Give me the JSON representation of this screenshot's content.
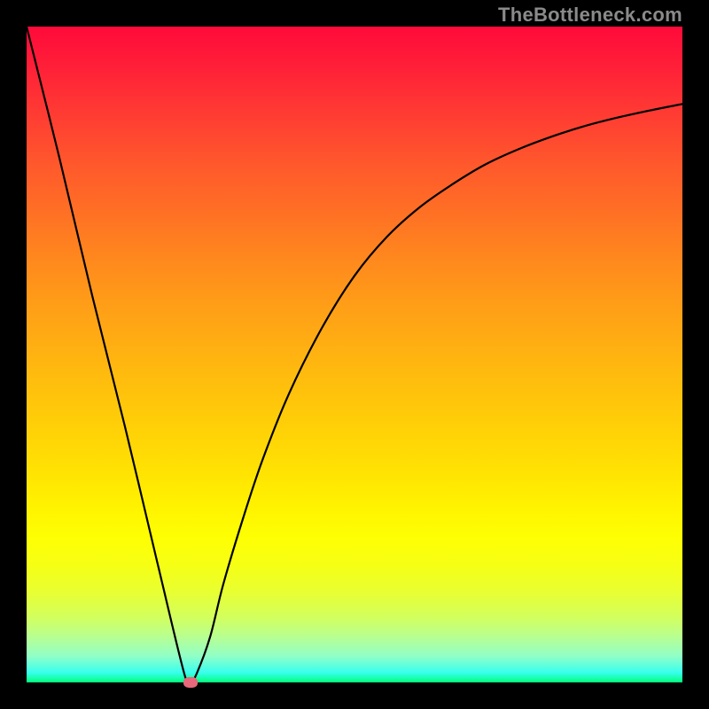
{
  "watermark": {
    "text": "TheBottleneck.com"
  },
  "chart_data": {
    "type": "line",
    "title": "",
    "xlabel": "",
    "ylabel": "",
    "xrange": [
      0,
      100
    ],
    "yrange": [
      0,
      100
    ],
    "background": "rainbow-gradient",
    "series": [
      {
        "name": "bottleneck-curve",
        "x": [
          0,
          5,
          10,
          15,
          20,
          24,
          25,
          26,
          28,
          30,
          33,
          36,
          40,
          45,
          50,
          55,
          60,
          65,
          70,
          75,
          80,
          85,
          90,
          95,
          100
        ],
        "y": [
          100,
          80,
          59,
          39,
          18,
          1.5,
          0,
          1.5,
          7,
          15,
          25,
          34,
          44,
          54,
          62,
          68,
          72.5,
          76,
          79,
          81.3,
          83.2,
          84.8,
          86.1,
          87.2,
          88.2
        ]
      }
    ],
    "marker": {
      "name": "minimum-point",
      "x": 25,
      "y": 0
    },
    "gradient_stops": [
      {
        "pos": 0,
        "color": "#ff0a3a"
      },
      {
        "pos": 50,
        "color": "#ffb80f"
      },
      {
        "pos": 78,
        "color": "#feff03"
      },
      {
        "pos": 100,
        "color": "#00ff7a"
      }
    ]
  }
}
